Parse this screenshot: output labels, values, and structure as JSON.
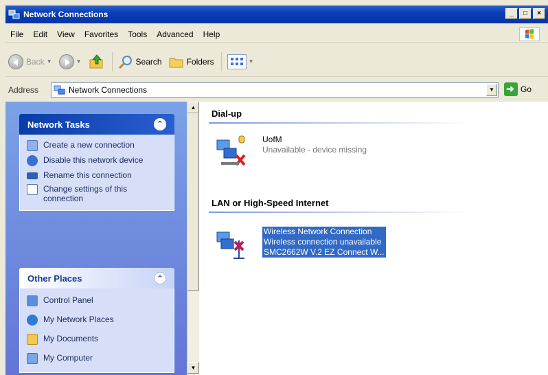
{
  "window": {
    "title": "Network Connections",
    "caption_buttons": {
      "minimize": "_",
      "maximize": "□",
      "close": "×"
    }
  },
  "menu": {
    "items": [
      "File",
      "Edit",
      "View",
      "Favorites",
      "Tools",
      "Advanced",
      "Help"
    ]
  },
  "toolbar": {
    "back_label": "Back",
    "search_label": "Search",
    "folders_label": "Folders"
  },
  "address": {
    "label": "Address",
    "value": "Network Connections",
    "go_label": "Go"
  },
  "left": {
    "network_tasks": {
      "title": "Network Tasks",
      "items": [
        {
          "label": "Create a new connection",
          "icon": "new-connection-icon"
        },
        {
          "label": "Disable this network device",
          "icon": "disable-device-icon"
        },
        {
          "label": "Rename this connection",
          "icon": "rename-icon"
        },
        {
          "label": "Change settings of this connection",
          "icon": "settings-icon"
        }
      ]
    },
    "other_places": {
      "title": "Other Places",
      "items": [
        {
          "label": "Control Panel",
          "icon": "control-panel-icon"
        },
        {
          "label": "My Network Places",
          "icon": "network-places-icon"
        },
        {
          "label": "My Documents",
          "icon": "documents-icon"
        },
        {
          "label": "My Computer",
          "icon": "computer-icon"
        }
      ]
    }
  },
  "content": {
    "groups": [
      {
        "title": "Dial-up",
        "connections": [
          {
            "name": "UofM",
            "status": "Unavailable - device missing",
            "selected": false
          }
        ]
      },
      {
        "title": "LAN or High-Speed Internet",
        "connections": [
          {
            "name": "Wireless Network Connection",
            "status": "Wireless connection unavailable",
            "device": "SMC2662W V.2 EZ Connect W...",
            "selected": true
          }
        ]
      }
    ]
  },
  "colors": {
    "titlebar": "#0a3db5",
    "taskpane_bg": "#6375d6",
    "selection": "#316ac5"
  }
}
